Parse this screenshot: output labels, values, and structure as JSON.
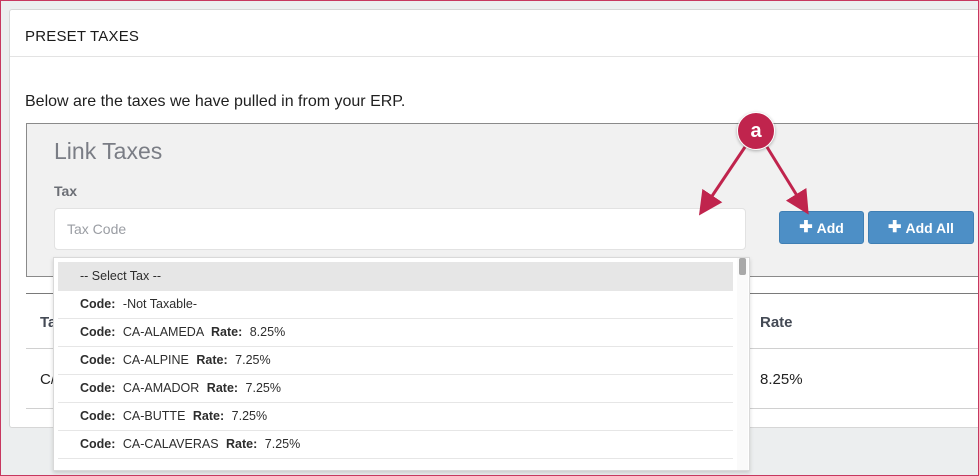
{
  "card": {
    "title": "PRESET TAXES",
    "intro": "Below are the taxes we have pulled in from your ERP."
  },
  "link_taxes": {
    "title": "Link Taxes",
    "tax_label": "Tax",
    "tax_placeholder": "Tax Code",
    "add_label": "Add",
    "add_all_label": "Add All",
    "plus_icon": "plus-icon"
  },
  "table": {
    "columns": [
      "Ta",
      "Rate"
    ],
    "rows": [
      {
        "code": "C/",
        "rate": "8.25%"
      }
    ]
  },
  "dropdown": {
    "items": [
      {
        "text": "-- Select Tax --"
      },
      {
        "code_label": "Code:",
        "code": "-Not Taxable-"
      },
      {
        "code_label": "Code:",
        "code": "CA-ALAMEDA",
        "rate_label": "Rate:",
        "rate": "8.25%"
      },
      {
        "code_label": "Code:",
        "code": "CA-ALPINE",
        "rate_label": "Rate:",
        "rate": "7.25%"
      },
      {
        "code_label": "Code:",
        "code": "CA-AMADOR",
        "rate_label": "Rate:",
        "rate": "7.25%"
      },
      {
        "code_label": "Code:",
        "code": "CA-BUTTE",
        "rate_label": "Rate:",
        "rate": "7.25%"
      },
      {
        "code_label": "Code:",
        "code": "CA-CALAVERAS",
        "rate_label": "Rate:",
        "rate": "7.25%"
      }
    ]
  },
  "annotation": {
    "label": "a",
    "color": "#c0244d"
  },
  "colors": {
    "button": "#4d8fc6",
    "frame_border": "#c7375f",
    "annotation": "#c0244d"
  }
}
